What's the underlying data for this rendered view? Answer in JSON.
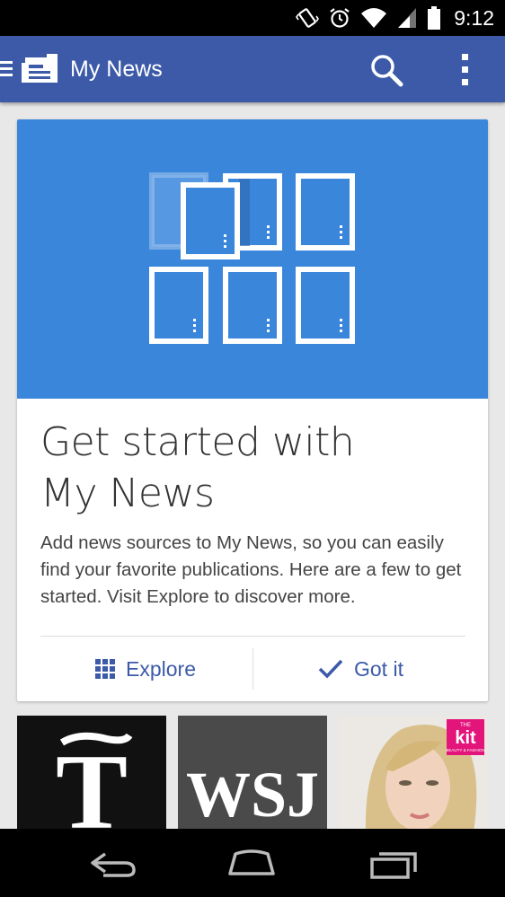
{
  "status_bar": {
    "time": "9:12",
    "icons": [
      "vibrate-icon",
      "alarm-icon",
      "wifi-icon",
      "signal-icon",
      "battery-icon"
    ]
  },
  "app_bar": {
    "title": "My News",
    "color": "#3c5aa8",
    "icons": [
      "menu-icon",
      "my-news-logo-icon",
      "search-icon",
      "overflow-menu-icon"
    ]
  },
  "card": {
    "hero_color": "#3a86db",
    "headline_line1": "Get started with",
    "headline_line2": "My News",
    "body": "Add news sources to My News, so you can easily find your favorite publications. Here are a few to get started. Visit Explore to discover more.",
    "explore_label": "Explore",
    "gotit_label": "Got it"
  },
  "tiles": [
    {
      "name": "nyt-tile",
      "logo": "T"
    },
    {
      "name": "wsj-tile",
      "logo": "WSJ"
    },
    {
      "name": "kit-tile",
      "logo": "kit",
      "sublogo_top": "THE",
      "sublogo_bottom": "BEAUTY & FASHION"
    }
  ],
  "nav_bar": {
    "icons": [
      "back-icon",
      "home-icon",
      "recents-icon"
    ]
  }
}
